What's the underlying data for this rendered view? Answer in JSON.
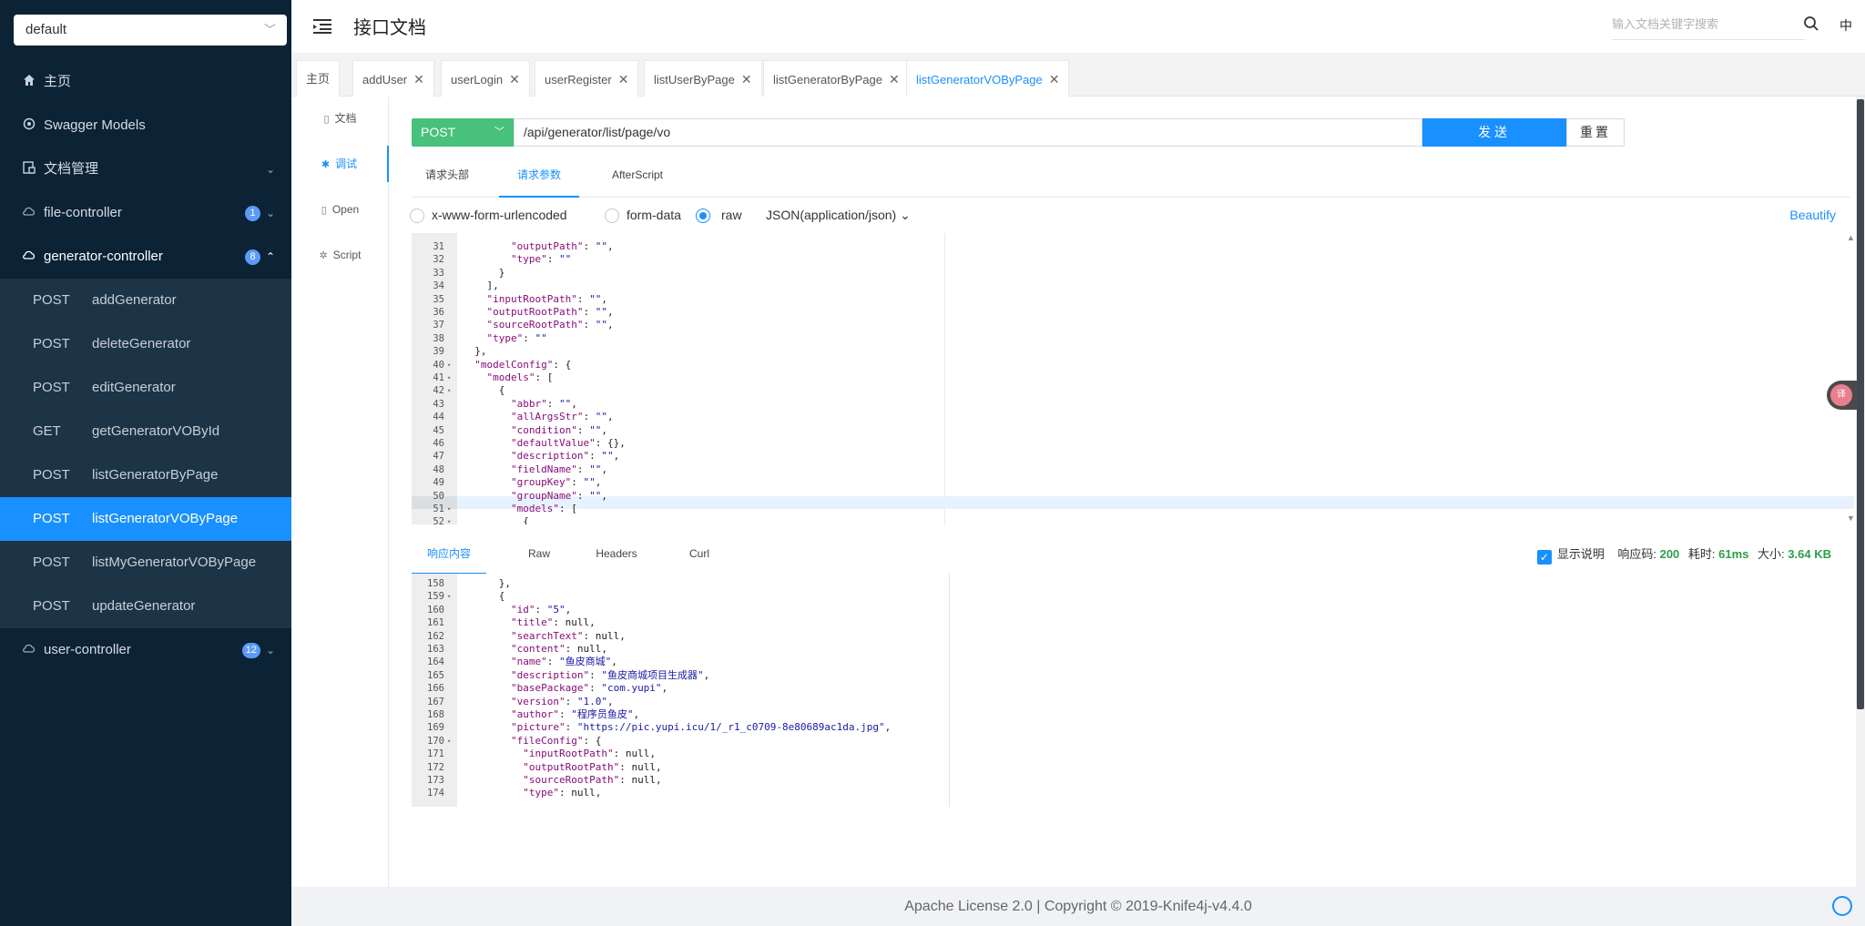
{
  "sidebar": {
    "group_select": "default",
    "nav": [
      {
        "label": "主页",
        "icon": "home-icon"
      },
      {
        "label": "Swagger Models",
        "icon": "models-icon"
      },
      {
        "label": "文档管理",
        "icon": "doc-manage-icon"
      },
      {
        "label": "file-controller",
        "icon": "cloud-icon",
        "badge": "1"
      },
      {
        "label": "generator-controller",
        "icon": "cloud-icon",
        "badge": "8"
      },
      {
        "label": "user-controller",
        "icon": "cloud-icon",
        "badge": "12"
      }
    ],
    "generator_endpoints": [
      {
        "method": "POST",
        "path": "addGenerator"
      },
      {
        "method": "POST",
        "path": "deleteGenerator"
      },
      {
        "method": "POST",
        "path": "editGenerator"
      },
      {
        "method": "GET",
        "path": "getGeneratorVOById"
      },
      {
        "method": "POST",
        "path": "listGeneratorByPage"
      },
      {
        "method": "POST",
        "path": "listGeneratorVOByPage"
      },
      {
        "method": "POST",
        "path": "listMyGeneratorVOByPage"
      },
      {
        "method": "POST",
        "path": "updateGenerator"
      }
    ]
  },
  "header": {
    "title": "接口文档",
    "search_placeholder": "输入文档关键字搜索",
    "lang": "中"
  },
  "tabs": [
    {
      "label": "主页",
      "closable": false
    },
    {
      "label": "addUser",
      "closable": true
    },
    {
      "label": "userLogin",
      "closable": true
    },
    {
      "label": "userRegister",
      "closable": true
    },
    {
      "label": "listUserByPage",
      "closable": true
    },
    {
      "label": "listGeneratorByPage",
      "closable": true
    },
    {
      "label": "listGeneratorVOByPage",
      "closable": true,
      "active": true
    }
  ],
  "docnav": [
    {
      "label": "文档",
      "icon": "document-icon"
    },
    {
      "label": "调试",
      "icon": "debug-icon",
      "active": true
    },
    {
      "label": "Open",
      "icon": "open-icon"
    },
    {
      "label": "Script",
      "icon": "script-icon"
    }
  ],
  "request": {
    "method": "POST",
    "url": "/api/generator/list/page/vo",
    "send_label": "发送",
    "reset_label": "重置",
    "sub_tabs": [
      "请求头部",
      "请求参数",
      "AfterScript"
    ],
    "body_types": [
      "x-www-form-urlencoded",
      "form-data",
      "raw"
    ],
    "selected_body_type": "raw",
    "content_type": "JSON(application/json)",
    "beautify_label": "Beautify",
    "editor_lines": [
      {
        "n": "31",
        "fold": "",
        "text": "        \"outputPath\": \"\","
      },
      {
        "n": "32",
        "fold": "",
        "text": "        \"type\": \"\""
      },
      {
        "n": "33",
        "fold": "",
        "text": "      }"
      },
      {
        "n": "34",
        "fold": "",
        "text": "    ],"
      },
      {
        "n": "35",
        "fold": "",
        "text": "    \"inputRootPath\": \"\","
      },
      {
        "n": "36",
        "fold": "",
        "text": "    \"outputRootPath\": \"\","
      },
      {
        "n": "37",
        "fold": "",
        "text": "    \"sourceRootPath\": \"\","
      },
      {
        "n": "38",
        "fold": "",
        "text": "    \"type\": \"\""
      },
      {
        "n": "39",
        "fold": "",
        "text": "  },"
      },
      {
        "n": "40",
        "fold": "▾",
        "text": "  \"modelConfig\": {"
      },
      {
        "n": "41",
        "fold": "▾",
        "text": "    \"models\": ["
      },
      {
        "n": "42",
        "fold": "▾",
        "text": "      {"
      },
      {
        "n": "43",
        "fold": "",
        "text": "        \"abbr\": \"\","
      },
      {
        "n": "44",
        "fold": "",
        "text": "        \"allArgsStr\": \"\","
      },
      {
        "n": "45",
        "fold": "",
        "text": "        \"condition\": \"\","
      },
      {
        "n": "46",
        "fold": "",
        "text": "        \"defaultValue\": {},"
      },
      {
        "n": "47",
        "fold": "",
        "text": "        \"description\": \"\","
      },
      {
        "n": "48",
        "fold": "",
        "text": "        \"fieldName\": \"\","
      },
      {
        "n": "49",
        "fold": "",
        "text": "        \"groupKey\": \"\","
      },
      {
        "n": "50",
        "fold": "",
        "text": "        \"groupName\": \"\","
      },
      {
        "n": "51",
        "fold": "▾",
        "text": "        \"models\": ["
      },
      {
        "n": "52",
        "fold": "▾",
        "text": "          {"
      }
    ]
  },
  "response": {
    "tabs": [
      "响应内容",
      "Raw",
      "Headers",
      "Curl"
    ],
    "show_desc_label": "显示说明",
    "status_label": "响应码:",
    "status_value": "200",
    "time_label": "耗时:",
    "time_value": "61ms",
    "size_label": "大小:",
    "size_value": "3.64 KB",
    "editor_lines": [
      {
        "n": "158",
        "fold": "",
        "text": "      },"
      },
      {
        "n": "159",
        "fold": "▾",
        "text": "      {"
      },
      {
        "n": "160",
        "fold": "",
        "text": "        \"id\": \"5\","
      },
      {
        "n": "161",
        "fold": "",
        "text": "        \"title\": null,"
      },
      {
        "n": "162",
        "fold": "",
        "text": "        \"searchText\": null,"
      },
      {
        "n": "163",
        "fold": "",
        "text": "        \"content\": null,"
      },
      {
        "n": "164",
        "fold": "",
        "text": "        \"name\": \"鱼皮商城\","
      },
      {
        "n": "165",
        "fold": "",
        "text": "        \"description\": \"鱼皮商城项目生成器\","
      },
      {
        "n": "166",
        "fold": "",
        "text": "        \"basePackage\": \"com.yupi\","
      },
      {
        "n": "167",
        "fold": "",
        "text": "        \"version\": \"1.0\","
      },
      {
        "n": "168",
        "fold": "",
        "text": "        \"author\": \"程序员鱼皮\","
      },
      {
        "n": "169",
        "fold": "",
        "text": "        \"picture\": \"https://pic.yupi.icu/1/_r1_c0709-8e80689ac1da.jpg\","
      },
      {
        "n": "170",
        "fold": "▾",
        "text": "        \"fileConfig\": {"
      },
      {
        "n": "171",
        "fold": "",
        "text": "          \"inputRootPath\": null,"
      },
      {
        "n": "172",
        "fold": "",
        "text": "          \"outputRootPath\": null,"
      },
      {
        "n": "173",
        "fold": "",
        "text": "          \"sourceRootPath\": null,"
      },
      {
        "n": "174",
        "fold": "",
        "text": "          \"type\": null,"
      }
    ]
  },
  "footer": {
    "text": "Apache License 2.0 | Copyright © 2019-Knife4j-v4.4.0"
  },
  "colors": {
    "sidebar_bg": "#0c2235",
    "submenu_bg": "#1d3346",
    "accent": "#1890ff",
    "post_method": "#47c17c",
    "status_ok": "#2e9d4d"
  }
}
